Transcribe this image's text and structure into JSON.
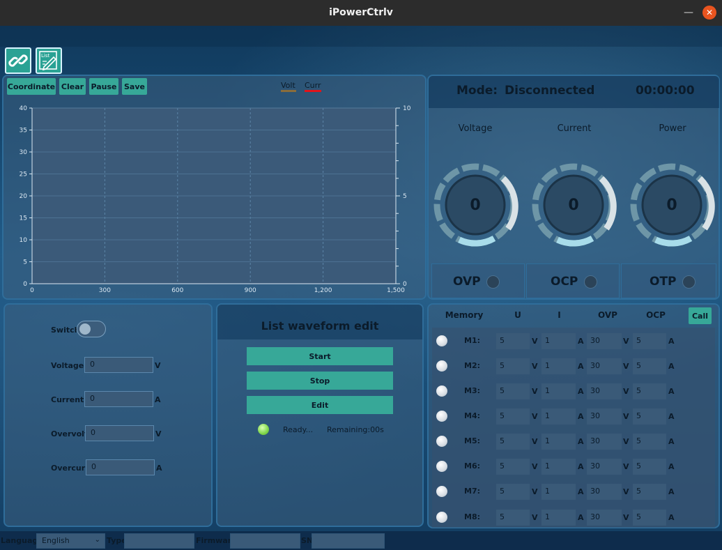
{
  "window": {
    "title": "iPowerCtrlv"
  },
  "toolbar": {
    "connect_icon": "link-icon",
    "list_icon": "list-edit-icon",
    "list_label": "List"
  },
  "chart_panel": {
    "buttons": [
      "Coordinate",
      "Clear",
      "Pause",
      "Save"
    ],
    "legend": [
      {
        "label": "Volt",
        "color": "#8a6d3b"
      },
      {
        "label": "Curr",
        "color": "#e0141b"
      }
    ]
  },
  "chart_data": {
    "type": "line",
    "title": "",
    "xlabel": "",
    "ylabel": "",
    "x_ticks": [
      "0",
      "300",
      "600",
      "900",
      "1,200",
      "1,500"
    ],
    "y_ticks": [
      "0",
      "5",
      "10",
      "15",
      "20",
      "25",
      "30",
      "35",
      "40"
    ],
    "y2_ticks": [
      "0",
      "5",
      "10"
    ],
    "xlim": [
      0,
      1500
    ],
    "ylim": [
      0,
      40
    ],
    "y2lim": [
      0,
      10
    ],
    "grid": true,
    "series": [
      {
        "name": "Volt",
        "color": "#8a6d3b",
        "values": []
      },
      {
        "name": "Curr",
        "color": "#e0141b",
        "values": []
      }
    ]
  },
  "mode_panel": {
    "mode_label": "Mode:",
    "mode_value": "Disconnected",
    "timer": "00:00:00",
    "gauges": [
      {
        "label": "Voltage",
        "value": "0"
      },
      {
        "label": "Current",
        "value": "0"
      },
      {
        "label": "Power",
        "value": "0"
      }
    ],
    "protections": [
      {
        "label": "OVP",
        "state": "off"
      },
      {
        "label": "OCP",
        "state": "off"
      },
      {
        "label": "OTP",
        "state": "off"
      }
    ]
  },
  "settings_panel": {
    "switch_label": "Switch",
    "switch_on": false,
    "voltage_label": "Voltage :",
    "voltage_value": "0",
    "voltage_unit": "V",
    "current_label": "Current :",
    "current_value": "0",
    "current_unit": "A",
    "overvolt_label": "Overvolt:",
    "overvolt_value": "0",
    "overvolt_unit": "V",
    "overcurr_label": "Overcurr:",
    "overcurr_value": "0",
    "overcurr_unit": "A"
  },
  "waveform_panel": {
    "title": "List waveform edit",
    "start": "Start",
    "stop": "Stop",
    "edit": "Edit",
    "status": "Ready...",
    "remaining": "Remaining:00s",
    "status_color": "#7fd64a"
  },
  "memory_panel": {
    "headers": {
      "memory": "Memory",
      "u": "U",
      "i": "I",
      "ovp": "OVP",
      "ocp": "OCP"
    },
    "call": "Call",
    "rows": [
      {
        "name": "M1:",
        "u": "5",
        "i": "1",
        "ovp": "30",
        "ocp": "5"
      },
      {
        "name": "M2:",
        "u": "5",
        "i": "1",
        "ovp": "30",
        "ocp": "5"
      },
      {
        "name": "M3:",
        "u": "5",
        "i": "1",
        "ovp": "30",
        "ocp": "5"
      },
      {
        "name": "M4:",
        "u": "5",
        "i": "1",
        "ovp": "30",
        "ocp": "5"
      },
      {
        "name": "M5:",
        "u": "5",
        "i": "1",
        "ovp": "30",
        "ocp": "5"
      },
      {
        "name": "M6:",
        "u": "5",
        "i": "1",
        "ovp": "30",
        "ocp": "5"
      },
      {
        "name": "M7:",
        "u": "5",
        "i": "1",
        "ovp": "30",
        "ocp": "5"
      },
      {
        "name": "M8:",
        "u": "5",
        "i": "1",
        "ovp": "30",
        "ocp": "5"
      }
    ],
    "unit_v": "V",
    "unit_a": "A"
  },
  "bottom_bar": {
    "language_label": "Language",
    "language_value": "English",
    "type_label": "Type",
    "type_value": "",
    "firmware_label": "Firmware",
    "firmware_value": "",
    "sn_label": "SN",
    "sn_value": ""
  },
  "colors": {
    "accent": "#37a898",
    "panel_border": "#2f6d9a"
  }
}
